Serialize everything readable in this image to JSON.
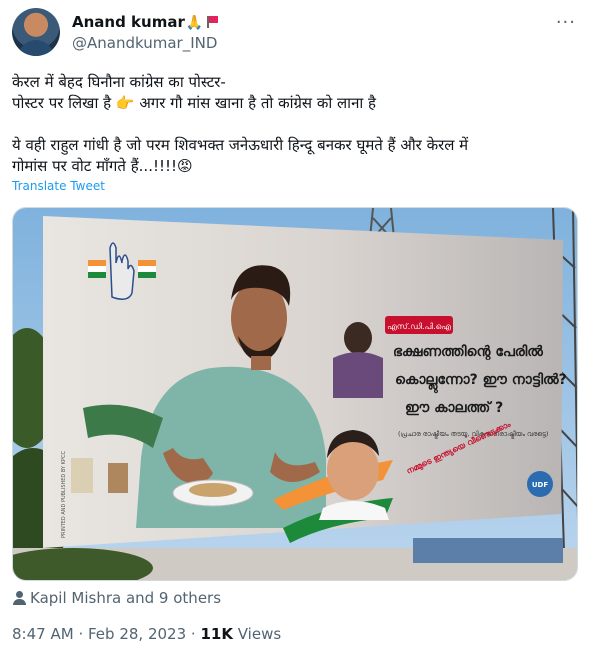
{
  "author": {
    "name": "Anand kumar",
    "name_emoji": "🙏",
    "handle": "@Anandkumar_IND"
  },
  "tweet": {
    "line1": "केरल में बेहद घिनौना कांग्रेस का पोस्टर-",
    "line2_prefix": "पोस्टर पर लिखा है",
    "line2_emoji": "👉",
    "line2_suffix": "अगर गौ मांस खाना है तो कांग्रेस को लाना है",
    "line3": "ये वही राहुल गांधी है जो परम शिवभक्त जनेऊधारी हिन्दू बनकर घूमते हैं और केरल में",
    "line4_text": "गोमांस पर वोट माँगते हैं...!!!!",
    "line4_emoji": "😡",
    "translate_label": "Translate Tweet"
  },
  "poster": {
    "tag": "എസ്.ഡി.പി.ഐ",
    "headline_line1": "ഭക്ഷണത്തിന്റെ പേരിൽ",
    "headline_line2": "കൊല്ലുന്നോ? ഈ നാട്ടിൽ?",
    "headline_line3": "ഈ കാലത്ത് ?",
    "subtext": "(പ്രചാര രാഷ്ട്രീയം തടയൂ, വികസനരാഷ്ട്രീയം വരട്ടെ)",
    "slogan": "നമ്മുടെ ഇന്ത്യയെ വീണ്ടെടുക്കാം",
    "party_logo": "UDF",
    "side_print": "PRINTED AND PUBLISHED BY KPCC"
  },
  "engagement": {
    "liked_by": "Kapil Mishra and 9 others"
  },
  "meta": {
    "time": "8:47 AM",
    "separator": "·",
    "date": "Feb 28, 2023",
    "views_count": "11K",
    "views_label": "Views"
  },
  "colors": {
    "link_blue": "#1d9bf0",
    "secondary_text": "#536471",
    "poster_red": "#c8102e",
    "sky_blue": "#9fc3e3"
  }
}
